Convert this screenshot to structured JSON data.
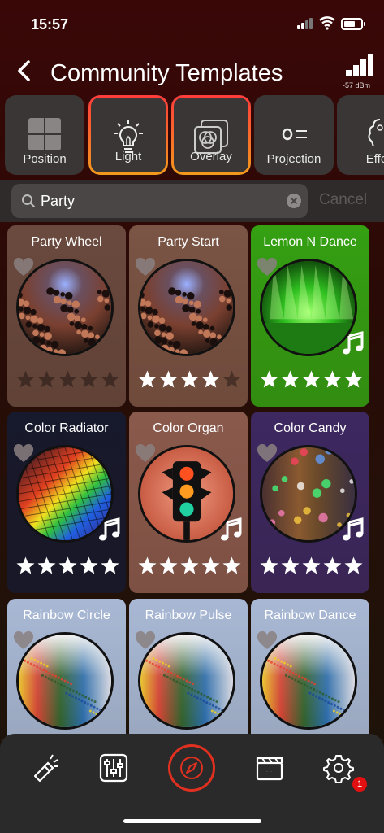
{
  "status": {
    "time": "15:57"
  },
  "header": {
    "title": "Community Templates",
    "signal": "-57 dBm"
  },
  "categories": [
    {
      "label": "Position",
      "icon": "grid-icon",
      "selected": false
    },
    {
      "label": "Light",
      "icon": "lightbulb-icon",
      "selected": true
    },
    {
      "label": "Overlay",
      "icon": "overlay-icon",
      "selected": true
    },
    {
      "label": "Projection",
      "icon": "projection-icon",
      "selected": false
    },
    {
      "label": "Effe",
      "icon": "effects-icon",
      "selected": false
    }
  ],
  "search": {
    "value": "Party",
    "cancel": "Cancel"
  },
  "templates": [
    {
      "name": "Party Wheel",
      "stars": 0,
      "music": false,
      "bg": "#6a4a3e",
      "art": "crowd"
    },
    {
      "name": "Party Start",
      "stars": 4,
      "music": false,
      "bg": "#7a5444",
      "art": "crowd"
    },
    {
      "name": "Lemon N Dance",
      "stars": 5,
      "music": true,
      "bg": "#34a012",
      "art": "green-stage"
    },
    {
      "name": "Color Radiator",
      "stars": 5,
      "music": true,
      "bg": "#17192c",
      "art": "prism"
    },
    {
      "name": "Color Organ",
      "stars": 5,
      "music": true,
      "bg": "#8a5a4c",
      "art": "traffic-light"
    },
    {
      "name": "Color Candy",
      "stars": 5,
      "music": true,
      "bg": "#3d2860",
      "art": "bokeh"
    },
    {
      "name": "Rainbow Circle",
      "stars": 0,
      "music": false,
      "bg": "#a8b8d4",
      "art": "sand"
    },
    {
      "name": "Rainbow Pulse",
      "stars": 0,
      "music": false,
      "bg": "#a8b8d4",
      "art": "sand"
    },
    {
      "name": "Rainbow Dance",
      "stars": 0,
      "music": false,
      "bg": "#a8b8d4",
      "art": "sand"
    }
  ],
  "nav": {
    "items": [
      "flashlight-icon",
      "mixer-icon",
      "compass-icon",
      "clapperboard-icon",
      "settings-icon"
    ],
    "badge": "1"
  },
  "colors": {
    "accent_red": "#ff3b3b",
    "accent_orange": "#f29a1c"
  }
}
